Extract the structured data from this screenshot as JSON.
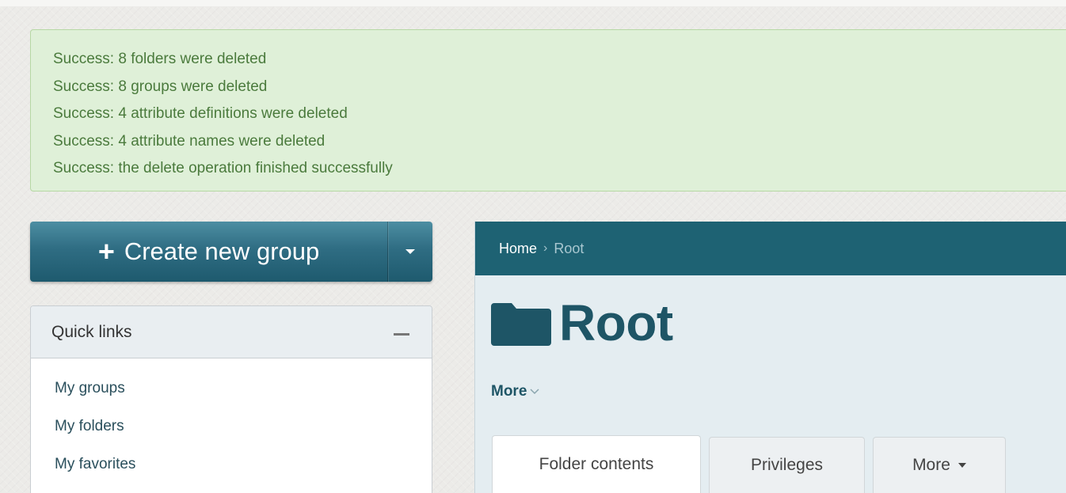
{
  "alert": {
    "messages": [
      "Success: 8 folders were deleted",
      "Success: 8 groups were deleted",
      "Success: 4 attribute definitions were deleted",
      "Success: 4 attribute names were deleted",
      "Success: the delete operation finished successfully"
    ]
  },
  "create_button": {
    "icon": "plus-icon",
    "label": "Create new group",
    "toggle_icon": "caret-down-icon"
  },
  "quick_links": {
    "title": "Quick links",
    "collapse_icon": "minus-icon",
    "items": [
      "My groups",
      "My folders",
      "My favorites"
    ]
  },
  "breadcrumb": {
    "home": "Home",
    "separator": "›",
    "current": "Root"
  },
  "page": {
    "icon": "folder-icon",
    "title": "Root",
    "more_menu": "More"
  },
  "tabs": [
    {
      "label": "Folder contents",
      "active": true
    },
    {
      "label": "Privileges",
      "active": false
    },
    {
      "label": "More",
      "active": false
    }
  ],
  "colors": {
    "alert_bg": "#dff0d8",
    "alert_text": "#4a7a3c",
    "brand_teal": "#1e6273",
    "title_color": "#1e5566"
  }
}
